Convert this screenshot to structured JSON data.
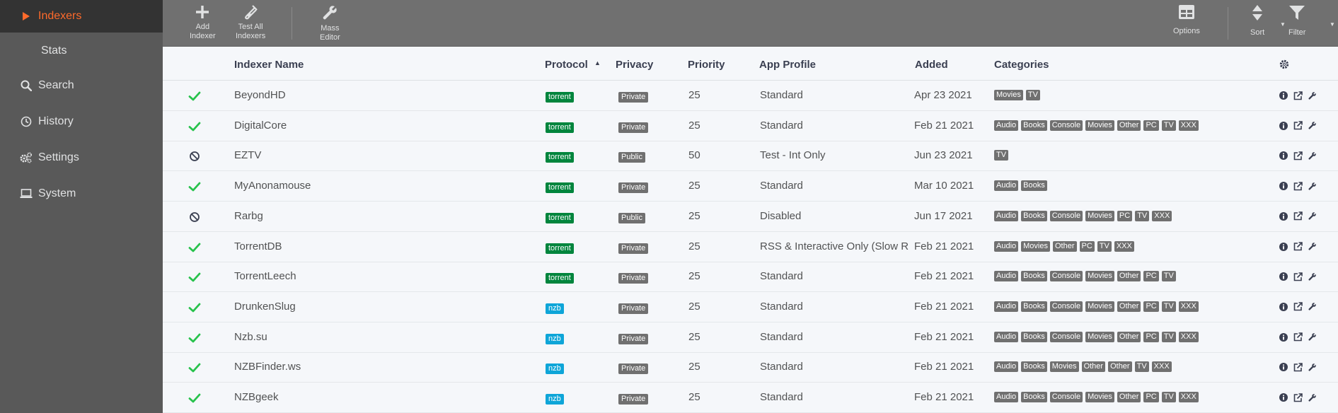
{
  "sidebar": {
    "items": [
      {
        "label": "Indexers",
        "icon": "play-icon"
      },
      {
        "label": "Stats",
        "icon": ""
      },
      {
        "label": "Search",
        "icon": "search-icon"
      },
      {
        "label": "History",
        "icon": "clock-icon"
      },
      {
        "label": "Settings",
        "icon": "gears-icon"
      },
      {
        "label": "System",
        "icon": "laptop-icon"
      }
    ]
  },
  "toolbar": {
    "add_line1": "Add",
    "add_line2": "Indexer",
    "test_line1": "Test All",
    "test_line2": "Indexers",
    "mass_line1": "Mass",
    "mass_line2": "Editor",
    "options": "Options",
    "sort": "Sort",
    "filter": "Filter"
  },
  "table": {
    "headers": {
      "name": "Indexer Name",
      "protocol": "Protocol",
      "privacy": "Privacy",
      "priority": "Priority",
      "app_profile": "App Profile",
      "added": "Added",
      "categories": "Categories"
    },
    "rows": [
      {
        "status": "enabled",
        "name": "BeyondHD",
        "protocol": "torrent",
        "privacy": "Private",
        "priority": "25",
        "app_profile": "Standard",
        "added": "Apr 23 2021",
        "categories": [
          "Movies",
          "TV"
        ]
      },
      {
        "status": "enabled",
        "name": "DigitalCore",
        "protocol": "torrent",
        "privacy": "Private",
        "priority": "25",
        "app_profile": "Standard",
        "added": "Feb 21 2021",
        "categories": [
          "Audio",
          "Books",
          "Console",
          "Movies",
          "Other",
          "PC",
          "TV",
          "XXX"
        ]
      },
      {
        "status": "disabled",
        "name": "EZTV",
        "protocol": "torrent",
        "privacy": "Public",
        "priority": "50",
        "app_profile": "Test - Int Only",
        "added": "Jun 23 2021",
        "categories": [
          "TV"
        ]
      },
      {
        "status": "enabled",
        "name": "MyAnonamouse",
        "protocol": "torrent",
        "privacy": "Private",
        "priority": "25",
        "app_profile": "Standard",
        "added": "Mar 10 2021",
        "categories": [
          "Audio",
          "Books"
        ]
      },
      {
        "status": "disabled",
        "name": "Rarbg",
        "protocol": "torrent",
        "privacy": "Public",
        "priority": "25",
        "app_profile": "Disabled",
        "added": "Jun 17 2021",
        "categories": [
          "Audio",
          "Books",
          "Console",
          "Movies",
          "PC",
          "TV",
          "XXX"
        ]
      },
      {
        "status": "enabled",
        "name": "TorrentDB",
        "protocol": "torrent",
        "privacy": "Private",
        "priority": "25",
        "app_profile": "RSS & Interactive Only (Slow R",
        "added": "Feb 21 2021",
        "categories": [
          "Audio",
          "Movies",
          "Other",
          "PC",
          "TV",
          "XXX"
        ]
      },
      {
        "status": "enabled",
        "name": "TorrentLeech",
        "protocol": "torrent",
        "privacy": "Private",
        "priority": "25",
        "app_profile": "Standard",
        "added": "Feb 21 2021",
        "categories": [
          "Audio",
          "Books",
          "Console",
          "Movies",
          "Other",
          "PC",
          "TV"
        ]
      },
      {
        "status": "enabled",
        "name": "DrunkenSlug",
        "protocol": "nzb",
        "privacy": "Private",
        "priority": "25",
        "app_profile": "Standard",
        "added": "Feb 21 2021",
        "categories": [
          "Audio",
          "Books",
          "Console",
          "Movies",
          "Other",
          "PC",
          "TV",
          "XXX"
        ]
      },
      {
        "status": "enabled",
        "name": "Nzb.su",
        "protocol": "nzb",
        "privacy": "Private",
        "priority": "25",
        "app_profile": "Standard",
        "added": "Feb 21 2021",
        "categories": [
          "Audio",
          "Books",
          "Console",
          "Movies",
          "Other",
          "PC",
          "TV",
          "XXX"
        ]
      },
      {
        "status": "enabled",
        "name": "NZBFinder.ws",
        "protocol": "nzb",
        "privacy": "Private",
        "priority": "25",
        "app_profile": "Standard",
        "added": "Feb 21 2021",
        "categories": [
          "Audio",
          "Books",
          "Movies",
          "Other",
          "Other",
          "TV",
          "XXX"
        ]
      },
      {
        "status": "enabled",
        "name": "NZBgeek",
        "protocol": "nzb",
        "privacy": "Private",
        "priority": "25",
        "app_profile": "Standard",
        "added": "Feb 21 2021",
        "categories": [
          "Audio",
          "Books",
          "Console",
          "Movies",
          "Other",
          "PC",
          "TV",
          "XXX"
        ]
      }
    ]
  },
  "colors": {
    "accent": "#ff6a2b",
    "enabled": "#27c24c",
    "torrent": "#00853d",
    "nzb": "#0ea5d8"
  }
}
